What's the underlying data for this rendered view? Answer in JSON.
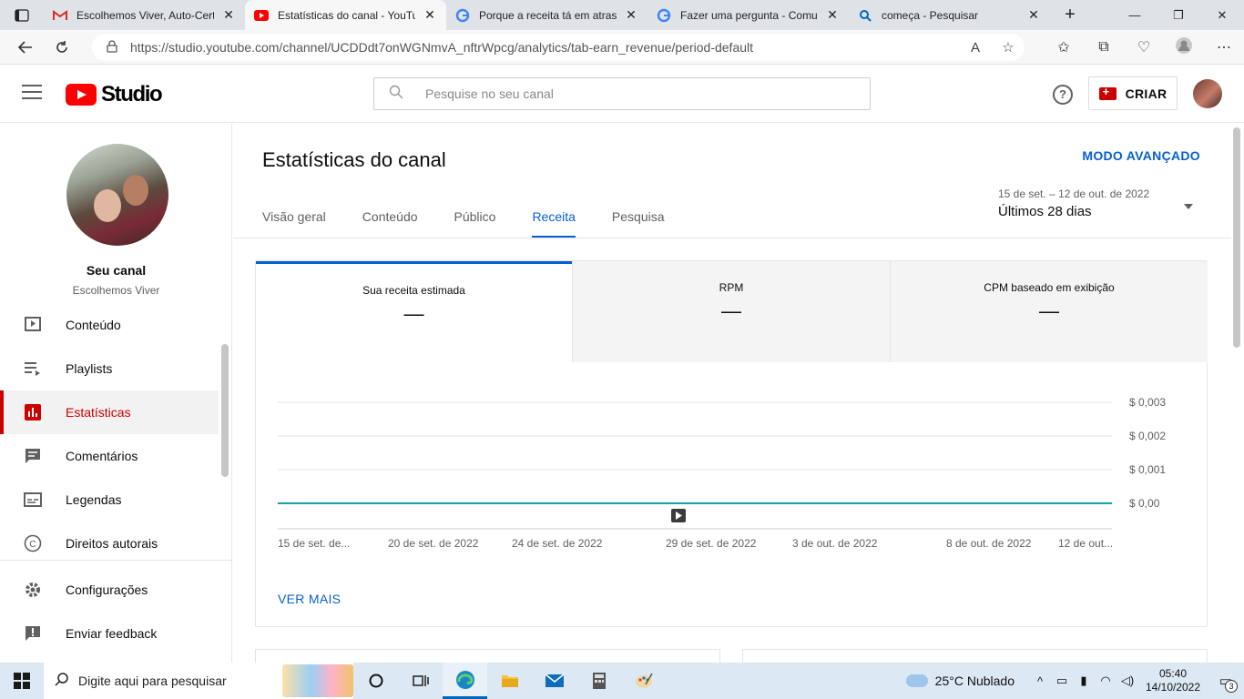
{
  "browser": {
    "tabs": [
      {
        "title": "Escolhemos Viver, Auto-Certif",
        "icon": "gmail-icon",
        "active": false
      },
      {
        "title": "Estatísticas do canal - YouTub",
        "icon": "youtube-icon",
        "active": true
      },
      {
        "title": "Porque a receita tá em atraso",
        "icon": "google-icon",
        "active": false
      },
      {
        "title": "Fazer uma pergunta - Comun",
        "icon": "google-icon",
        "active": false
      },
      {
        "title": "começa - Pesquisar",
        "icon": "search-icon",
        "active": false
      }
    ],
    "url": "https://studio.youtube.com/channel/UCDDdt7onWGNmvA_nftrWpcg/analytics/tab-earn_revenue/period-default",
    "read_aloud_glyph": "A",
    "new_tab_glyph": "+",
    "window_controls": [
      "—",
      "❐",
      "✕"
    ]
  },
  "studio": {
    "logo_text": "Studio",
    "search_placeholder": "Pesquise no seu canal",
    "help_glyph": "?",
    "create_label": "CRIAR"
  },
  "sidebar": {
    "channel_title": "Seu canal",
    "channel_name": "Escolhemos Viver",
    "items": [
      {
        "label": "Conteúdo",
        "icon": "content-icon"
      },
      {
        "label": "Playlists",
        "icon": "playlists-icon"
      },
      {
        "label": "Estatísticas",
        "icon": "analytics-icon",
        "active": true
      },
      {
        "label": "Comentários",
        "icon": "comments-icon"
      },
      {
        "label": "Legendas",
        "icon": "subtitles-icon"
      },
      {
        "label": "Direitos autorais",
        "icon": "copyright-icon"
      },
      {
        "label": "Configurações",
        "icon": "settings-icon"
      },
      {
        "label": "Enviar feedback",
        "icon": "feedback-icon"
      }
    ]
  },
  "main": {
    "title": "Estatísticas do canal",
    "advanced_mode": "MODO AVANÇADO",
    "tabs": [
      "Visão geral",
      "Conteúdo",
      "Público",
      "Receita",
      "Pesquisa"
    ],
    "selected_tab": "Receita",
    "date_range": {
      "dates": "15 de set. – 12 de out. de 2022",
      "label": "Últimos 28 dias"
    },
    "metrics": [
      {
        "label": "Sua receita estimada",
        "value": "—",
        "selected": true
      },
      {
        "label": "RPM",
        "value": "—",
        "selected": false
      },
      {
        "label": "CPM baseado em exibição",
        "value": "—",
        "selected": false
      }
    ],
    "see_more": "VER MAIS"
  },
  "chart_data": {
    "type": "line",
    "x": [
      "15 de set. de...",
      "20 de set. de 2022",
      "24 de set. de 2022",
      "29 de set. de 2022",
      "3 de out. de 2022",
      "8 de out. de 2022",
      "12 de out..."
    ],
    "y_ticks": [
      "$ 0,003",
      "$ 0,002",
      "$ 0,001",
      "$ 0,00"
    ],
    "ylim": [
      0,
      0.003
    ],
    "series": [
      {
        "values": [
          0,
          0,
          0,
          0,
          0,
          0,
          0
        ]
      }
    ],
    "line_color": "#12a4a6",
    "grid": true
  },
  "taskbar": {
    "search_placeholder": "Digite aqui para pesquisar",
    "weather": "25°C  Nublado",
    "time": "05:40",
    "date": "14/10/2022",
    "notification_count": "3"
  }
}
